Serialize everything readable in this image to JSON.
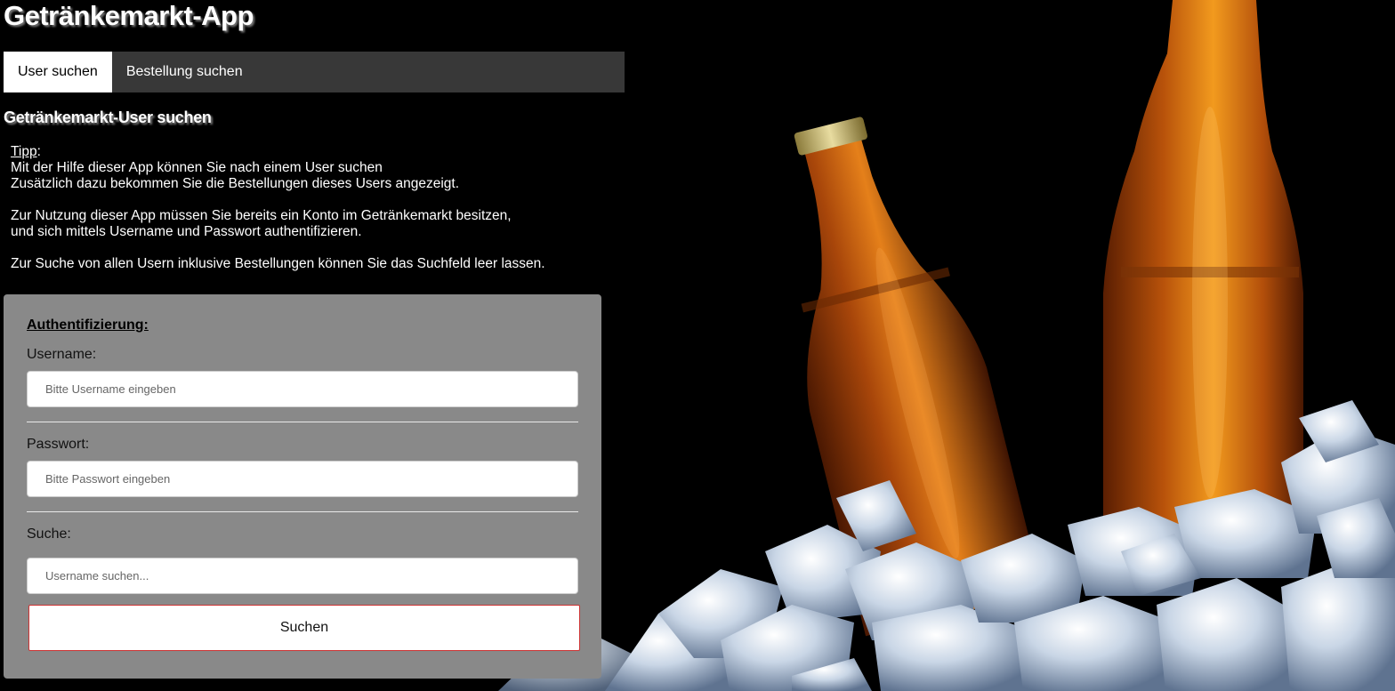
{
  "app": {
    "title": "Getränkemarkt-App"
  },
  "tabs": [
    {
      "label": "User suchen",
      "active": true
    },
    {
      "label": "Bestellung suchen",
      "active": false
    }
  ],
  "main": {
    "section_title": "Getränkemarkt-User suchen",
    "tipp": {
      "heading": "Tipp",
      "heading_suffix": ":",
      "lines": [
        "Mit der Hilfe dieser App können Sie nach einem User suchen",
        "Zusätzlich dazu bekommen Sie die Bestellungen dieses Users angezeigt.",
        "Zur Nutzung dieser App müssen Sie bereits ein Konto im Getränkemarkt besitzen,",
        "und sich mittels Username und Passwort authentifizieren.",
        "Zur Suche von allen Usern inklusive Bestellungen können Sie das Suchfeld leer lassen."
      ]
    }
  },
  "form": {
    "heading": "Authentifizierung:",
    "username": {
      "label": "Username:",
      "placeholder": "Bitte Username eingeben",
      "value": ""
    },
    "password": {
      "label": "Passwort:",
      "placeholder": "Bitte Passwort eingeben",
      "value": ""
    },
    "search": {
      "label": "Suche:",
      "placeholder": "Username suchen...",
      "value": ""
    },
    "submit_label": "Suchen"
  },
  "colors": {
    "background": "#000000",
    "tabbar": "#383838",
    "form_card": "#898989",
    "button_border": "#cc3333"
  },
  "hero_image": {
    "icon": "beer-bottles-on-ice-image"
  }
}
